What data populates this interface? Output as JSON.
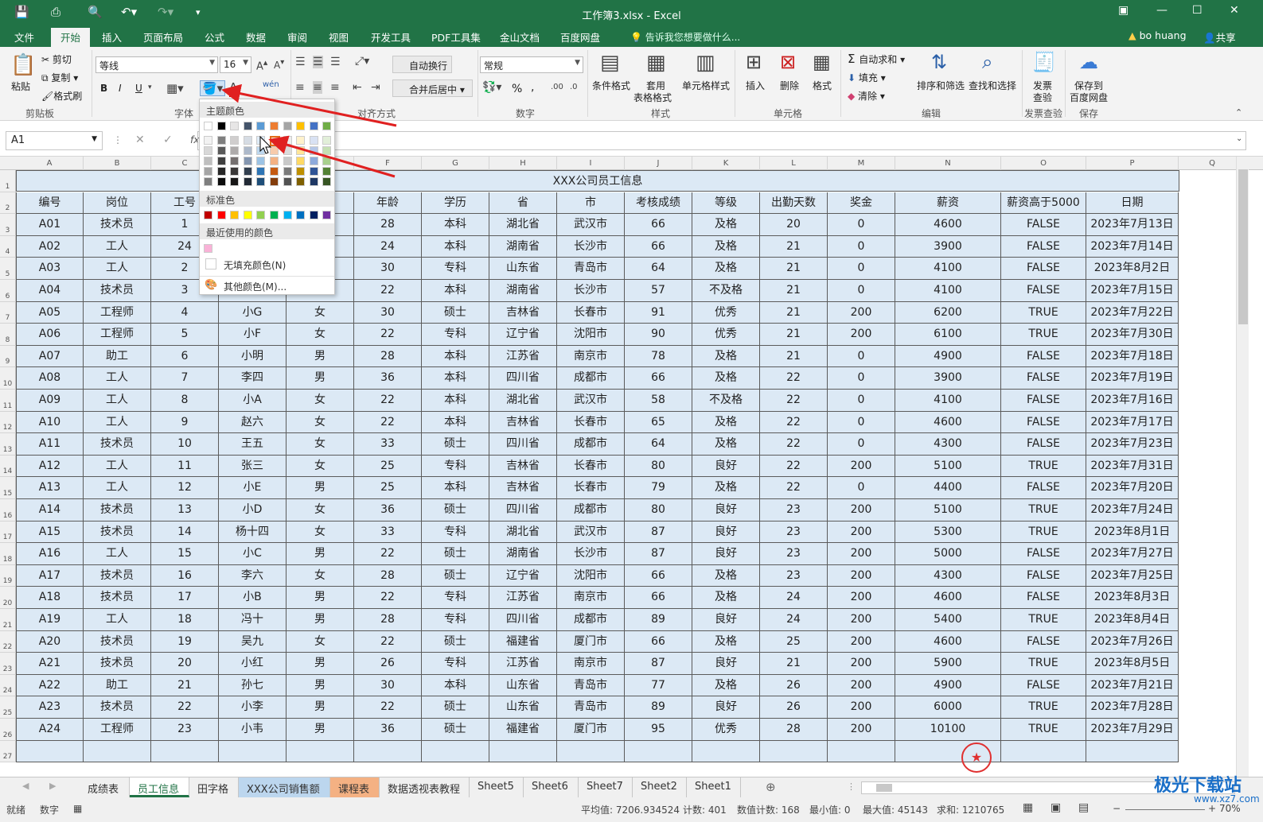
{
  "title": "工作簿3.xlsx - Excel",
  "tabs": [
    "文件",
    "开始",
    "插入",
    "页面布局",
    "公式",
    "数据",
    "审阅",
    "视图",
    "开发工具",
    "PDF工具集",
    "金山文档",
    "百度网盘"
  ],
  "tell_me": "告诉我您想要做什么...",
  "user": "bo huang",
  "share": "共享",
  "ribbon": {
    "clipboard": {
      "paste": "粘贴",
      "cut": "剪切",
      "copy": "复制",
      "format_painter": "格式刷",
      "label": "剪贴板"
    },
    "font": {
      "name": "等线",
      "size": "16",
      "bold": "B",
      "italic": "I",
      "underline": "U",
      "label": "字体",
      "wen": "wén"
    },
    "alignment": {
      "wrap": "自动换行",
      "merge": "合并后居中",
      "label": "对齐方式"
    },
    "number": {
      "format": "常规",
      "percent": "%",
      "comma": ",",
      "label": "数字"
    },
    "styles": {
      "conditional": "条件格式",
      "table_l1": "套用",
      "table_l2": "表格格式",
      "cell_styles": "单元格样式",
      "label": "样式"
    },
    "cells": {
      "insert": "插入",
      "delete": "删除",
      "format": "格式",
      "label": "单元格"
    },
    "editing": {
      "autosum": "自动求和",
      "fill": "填充",
      "clear": "清除",
      "sort": "排序和筛选",
      "find": "查找和选择",
      "label": "编辑"
    },
    "invoice": {
      "l1": "发票",
      "l2": "查验",
      "label": "发票查验"
    },
    "baidu": {
      "l1": "保存到",
      "l2": "百度网盘",
      "label": "保存"
    }
  },
  "namebox": "A1",
  "fx": "fx",
  "columns": [
    "A",
    "B",
    "C",
    "D",
    "E",
    "F",
    "G",
    "H",
    "I",
    "J",
    "K",
    "L",
    "M",
    "N",
    "O",
    "P",
    "Q"
  ],
  "row_numbers": [
    "1",
    "2",
    "3",
    "4",
    "5",
    "6",
    "7",
    "8",
    "9",
    "10",
    "11",
    "12",
    "13",
    "14",
    "15",
    "16",
    "17",
    "18",
    "19",
    "20",
    "21",
    "22",
    "23",
    "24",
    "25",
    "26",
    "27"
  ],
  "sheet_title": "XXX公司员工信息",
  "headers": [
    "编号",
    "岗位",
    "工号",
    "",
    "",
    "年龄",
    "学历",
    "省",
    "市",
    "考核成绩",
    "等级",
    "出勤天数",
    "奖金",
    "薪资",
    "薪资高于5000",
    "日期"
  ],
  "rows": [
    [
      "A01",
      "技术员",
      "1",
      "",
      "",
      "28",
      "本科",
      "湖北省",
      "武汉市",
      "66",
      "及格",
      "20",
      "0",
      "4600",
      "FALSE",
      "2023年7月13日"
    ],
    [
      "A02",
      "工人",
      "24",
      "",
      "",
      "24",
      "本科",
      "湖南省",
      "长沙市",
      "66",
      "及格",
      "21",
      "0",
      "3900",
      "FALSE",
      "2023年7月14日"
    ],
    [
      "A03",
      "工人",
      "2",
      "",
      "",
      "30",
      "专科",
      "山东省",
      "青岛市",
      "64",
      "及格",
      "21",
      "0",
      "4100",
      "FALSE",
      "2023年8月2日"
    ],
    [
      "A04",
      "技术员",
      "3",
      "",
      "",
      "22",
      "本科",
      "湖南省",
      "长沙市",
      "57",
      "不及格",
      "21",
      "0",
      "4100",
      "FALSE",
      "2023年7月15日"
    ],
    [
      "A05",
      "工程师",
      "4",
      "小G",
      "女",
      "30",
      "硕士",
      "吉林省",
      "长春市",
      "91",
      "优秀",
      "21",
      "200",
      "6200",
      "TRUE",
      "2023年7月22日"
    ],
    [
      "A06",
      "工程师",
      "5",
      "小F",
      "女",
      "22",
      "专科",
      "辽宁省",
      "沈阳市",
      "90",
      "优秀",
      "21",
      "200",
      "6100",
      "TRUE",
      "2023年7月30日"
    ],
    [
      "A07",
      "助工",
      "6",
      "小明",
      "男",
      "28",
      "本科",
      "江苏省",
      "南京市",
      "78",
      "及格",
      "21",
      "0",
      "4900",
      "FALSE",
      "2023年7月18日"
    ],
    [
      "A08",
      "工人",
      "7",
      "李四",
      "男",
      "36",
      "本科",
      "四川省",
      "成都市",
      "66",
      "及格",
      "22",
      "0",
      "3900",
      "FALSE",
      "2023年7月19日"
    ],
    [
      "A09",
      "工人",
      "8",
      "小A",
      "女",
      "22",
      "本科",
      "湖北省",
      "武汉市",
      "58",
      "不及格",
      "22",
      "0",
      "4100",
      "FALSE",
      "2023年7月16日"
    ],
    [
      "A10",
      "工人",
      "9",
      "赵六",
      "女",
      "22",
      "本科",
      "吉林省",
      "长春市",
      "65",
      "及格",
      "22",
      "0",
      "4600",
      "FALSE",
      "2023年7月17日"
    ],
    [
      "A11",
      "技术员",
      "10",
      "王五",
      "女",
      "33",
      "硕士",
      "四川省",
      "成都市",
      "64",
      "及格",
      "22",
      "0",
      "4300",
      "FALSE",
      "2023年7月23日"
    ],
    [
      "A12",
      "工人",
      "11",
      "张三",
      "女",
      "25",
      "专科",
      "吉林省",
      "长春市",
      "80",
      "良好",
      "22",
      "200",
      "5100",
      "TRUE",
      "2023年7月31日"
    ],
    [
      "A13",
      "工人",
      "12",
      "小E",
      "男",
      "25",
      "本科",
      "吉林省",
      "长春市",
      "79",
      "及格",
      "22",
      "0",
      "4400",
      "FALSE",
      "2023年7月20日"
    ],
    [
      "A14",
      "技术员",
      "13",
      "小D",
      "女",
      "36",
      "硕士",
      "四川省",
      "成都市",
      "80",
      "良好",
      "23",
      "200",
      "5100",
      "TRUE",
      "2023年7月24日"
    ],
    [
      "A15",
      "技术员",
      "14",
      "杨十四",
      "女",
      "33",
      "专科",
      "湖北省",
      "武汉市",
      "87",
      "良好",
      "23",
      "200",
      "5300",
      "TRUE",
      "2023年8月1日"
    ],
    [
      "A16",
      "工人",
      "15",
      "小C",
      "男",
      "22",
      "硕士",
      "湖南省",
      "长沙市",
      "87",
      "良好",
      "23",
      "200",
      "5000",
      "FALSE",
      "2023年7月27日"
    ],
    [
      "A17",
      "技术员",
      "16",
      "李六",
      "女",
      "28",
      "硕士",
      "辽宁省",
      "沈阳市",
      "66",
      "及格",
      "23",
      "200",
      "4300",
      "FALSE",
      "2023年7月25日"
    ],
    [
      "A18",
      "技术员",
      "17",
      "小B",
      "男",
      "22",
      "专科",
      "江苏省",
      "南京市",
      "66",
      "及格",
      "24",
      "200",
      "4600",
      "FALSE",
      "2023年8月3日"
    ],
    [
      "A19",
      "工人",
      "18",
      "冯十",
      "男",
      "28",
      "专科",
      "四川省",
      "成都市",
      "89",
      "良好",
      "24",
      "200",
      "5400",
      "TRUE",
      "2023年8月4日"
    ],
    [
      "A20",
      "技术员",
      "19",
      "吴九",
      "女",
      "22",
      "硕士",
      "福建省",
      "厦门市",
      "66",
      "及格",
      "25",
      "200",
      "4600",
      "FALSE",
      "2023年7月26日"
    ],
    [
      "A21",
      "技术员",
      "20",
      "小红",
      "男",
      "26",
      "专科",
      "江苏省",
      "南京市",
      "87",
      "良好",
      "21",
      "200",
      "5900",
      "TRUE",
      "2023年8月5日"
    ],
    [
      "A22",
      "助工",
      "21",
      "孙七",
      "男",
      "30",
      "本科",
      "山东省",
      "青岛市",
      "77",
      "及格",
      "26",
      "200",
      "4900",
      "FALSE",
      "2023年7月21日"
    ],
    [
      "A23",
      "技术员",
      "22",
      "小李",
      "男",
      "22",
      "硕士",
      "山东省",
      "青岛市",
      "89",
      "良好",
      "26",
      "200",
      "6000",
      "TRUE",
      "2023年7月28日"
    ],
    [
      "A24",
      "工程师",
      "23",
      "小韦",
      "男",
      "36",
      "硕士",
      "福建省",
      "厦门市",
      "95",
      "优秀",
      "28",
      "200",
      "10100",
      "TRUE",
      "2023年7月29日"
    ]
  ],
  "popup": {
    "theme_label": "主题颜色",
    "standard_label": "标准色",
    "recent_label": "最近使用的颜色",
    "no_fill": "无填充颜色(N)",
    "more": "其他颜色(M)...",
    "theme_top": [
      "#ffffff",
      "#000000",
      "#e7e6e6",
      "#44546a",
      "#5b9bd5",
      "#ed7d31",
      "#a5a5a5",
      "#ffc000",
      "#4472c4",
      "#70ad47"
    ],
    "theme_shades": [
      [
        "#f2f2f2",
        "#7f7f7f",
        "#d0cece",
        "#d6dce4",
        "#deebf6",
        "#fbe5d5",
        "#ededed",
        "#fff2cc",
        "#d9e2f3",
        "#e2efd9"
      ],
      [
        "#d8d8d8",
        "#595959",
        "#aeabab",
        "#adb9ca",
        "#bdd7ee",
        "#f7cbac",
        "#dbdbdb",
        "#fee599",
        "#b4c6e7",
        "#c5e0b3"
      ],
      [
        "#bfbfbf",
        "#3f3f3f",
        "#757070",
        "#8496b0",
        "#9cc3e5",
        "#f4b183",
        "#c9c9c9",
        "#ffd965",
        "#8eaadb",
        "#a8d08d"
      ],
      [
        "#a5a5a5",
        "#262626",
        "#3a3838",
        "#323f4f",
        "#2e75b5",
        "#c55a11",
        "#7b7b7b",
        "#bf9000",
        "#2f5496",
        "#538135"
      ],
      [
        "#7f7f7f",
        "#0c0c0c",
        "#171616",
        "#222a35",
        "#1e4e79",
        "#833c0b",
        "#525252",
        "#7f6000",
        "#1f3864",
        "#375623"
      ]
    ],
    "standard": [
      "#c00000",
      "#ff0000",
      "#ffc000",
      "#ffff00",
      "#92d050",
      "#00b050",
      "#00b0f0",
      "#0070c0",
      "#002060",
      "#7030a0"
    ],
    "recent": [
      "#f9b2d7"
    ]
  },
  "sheet_tabs": [
    "成绩表",
    "员工信息",
    "田字格",
    "XXX公司销售额",
    "课程表",
    "数据透视表教程",
    "Sheet5",
    "Sheet6",
    "Sheet7",
    "Sheet2",
    "Sheet1"
  ],
  "status": {
    "ready": "就绪",
    "num": "数字",
    "avg": "平均值: 7206.934524",
    "count": "计数: 401",
    "numcount": "数值计数: 168",
    "min": "最小值: 0",
    "max": "最大值: 45143",
    "sum": "求和: 1210765",
    "zoom": "70%"
  },
  "watermark": {
    "name": "极光下载站",
    "url": "www.xz7.com"
  },
  "colors": {
    "excel_green": "#217346",
    "cell_fill": "#dce9f5",
    "arrow": "#e02020"
  }
}
